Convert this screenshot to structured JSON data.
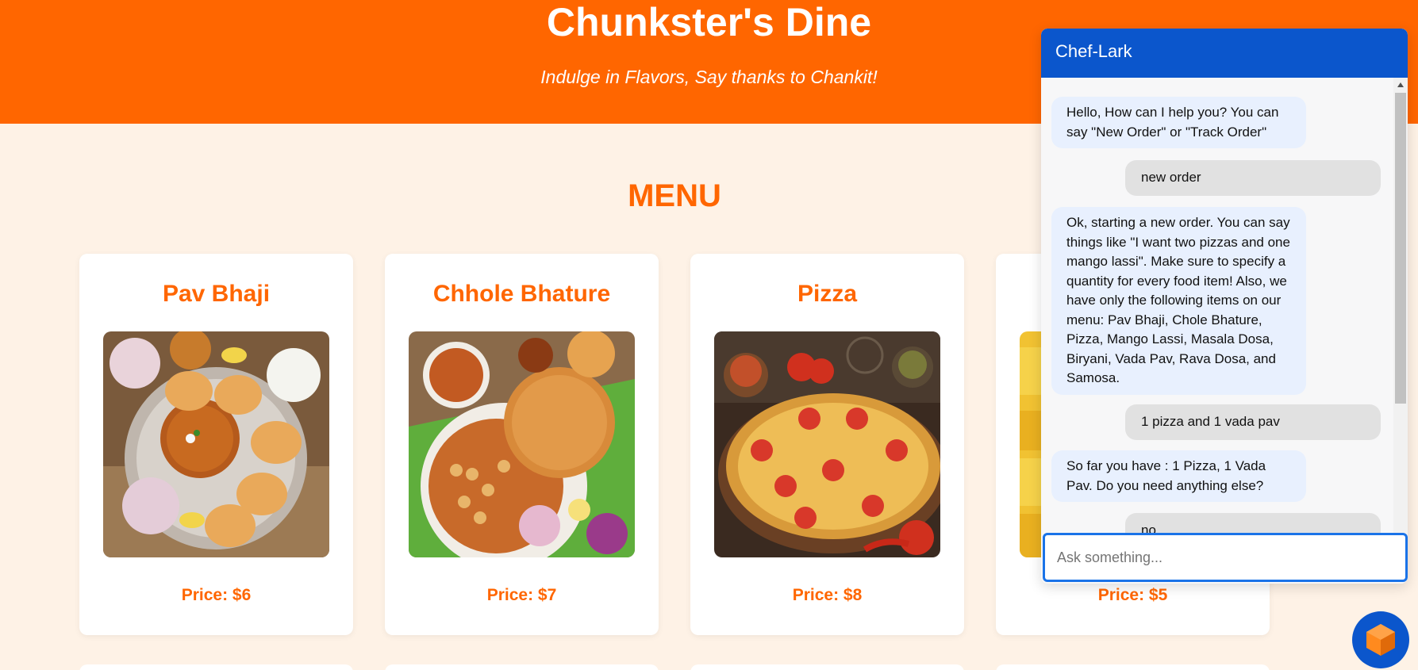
{
  "header": {
    "title": "Chunkster's Dine",
    "tagline": "Indulge in Flavors, Say thanks to Chankit!"
  },
  "menu": {
    "heading": "MENU",
    "items": [
      {
        "name": "Pav Bhaji",
        "price": "Price: $6"
      },
      {
        "name": "Chhole Bhature",
        "price": "Price: $7"
      },
      {
        "name": "Pizza",
        "price": "Price: $8"
      },
      {
        "name": "",
        "price": "Price: $5"
      }
    ]
  },
  "chat": {
    "title": "Chef-Lark",
    "messages": [
      {
        "from": "bot",
        "text": "Hello, How can I help you? You can say \"New Order\" or \"Track Order\""
      },
      {
        "from": "user",
        "text": "new order"
      },
      {
        "from": "bot",
        "text": "Ok, starting a new order. You can say things like \"I want two pizzas and one mango lassi\". Make sure to specify a quantity for every food item! Also, we have only the following items on our menu: Pav Bhaji, Chole Bhature, Pizza, Mango Lassi, Masala Dosa, Biryani, Vada Pav, Rava Dosa, and Samosa."
      },
      {
        "from": "user",
        "text": "1 pizza and 1 vada pav"
      },
      {
        "from": "bot",
        "text": "So far you have : 1 Pizza, 1 Vada Pav. Do you need anything else?"
      },
      {
        "from": "user",
        "text": "no"
      }
    ],
    "input_placeholder": "Ask something...",
    "input_value": ""
  },
  "colors": {
    "brand_orange": "#ff6600",
    "page_background": "#fef2e6",
    "chat_blue": "#0b56cc",
    "bot_bubble": "#e8f0fe",
    "user_bubble": "#e1e1e1"
  },
  "icons": {
    "chat_launcher": "dialogflow-cube-icon"
  }
}
